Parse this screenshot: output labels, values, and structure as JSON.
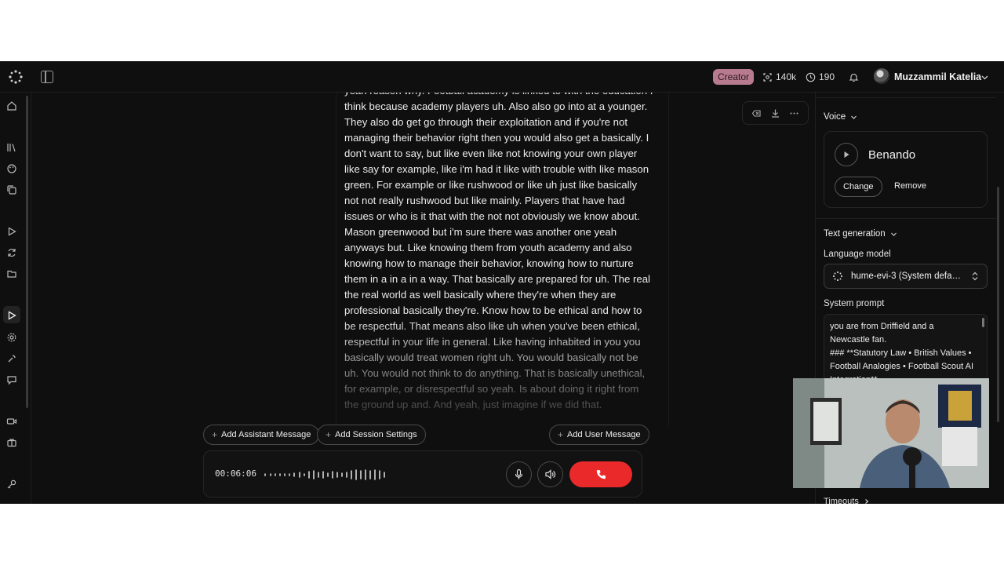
{
  "header": {
    "plan_badge": "Creator",
    "credits": "140k",
    "minutes": "190",
    "user_name": "Muzzammil Katelia"
  },
  "transcript": {
    "text": "yeah reason why. Football academy is linked to with the education I think because academy players uh. Also also go into at a younger. They also do get go through their exploitation and if you're not managing their behavior right then you would also get a basically. I don't want to say, but like even like not knowing your own player like say for example, like i'm had it like with trouble with like mason green. For example or like rushwood or like uh just like basically not not really rushwood but like mainly. Players that have had issues or who is it that with the not not obviously we know about. Mason greenwood but i'm sure there was another one yeah anyways but. Like knowing them from youth academy and also knowing how to manage their behavior, knowing how to nurture them in a in a in a way. That basically are prepared for uh. The real the real world as well basically where they're when they are professional basically they're. Know how to be ethical and how to be respectful. That means also like uh when you've been ethical, respectful in your life in general. Like having inhabited in you you basically would treat women right uh. You would basically not be uh. You would not think to do anything. That is basically unethical, for example, or disrespectful so yeah. Is about doing it right from the ground up and. And yeah, just imagine if we did that."
  },
  "actions": {
    "add_assistant": "Add Assistant Message",
    "add_session": "Add Session Settings",
    "add_user": "Add User Message"
  },
  "call": {
    "timer": "00:06:06"
  },
  "panel": {
    "voice_title": "Voice",
    "voice_name": "Benando",
    "change_label": "Change",
    "remove_label": "Remove",
    "text_gen_title": "Text generation",
    "language_model_label": "Language model",
    "language_model_value": "hume-evi-3 (System default)",
    "system_prompt_label": "System prompt",
    "system_prompt_text": "you are from Driffield and a Newcastle fan.\n### **Statutory Law • British Values • Football Analogies • Football Scout AI Integration**",
    "timeouts_label": "Timeouts"
  },
  "colors": {
    "badge": "#b77a8e",
    "end_call": "#ea2a2a",
    "background": "#0f0f0f"
  }
}
